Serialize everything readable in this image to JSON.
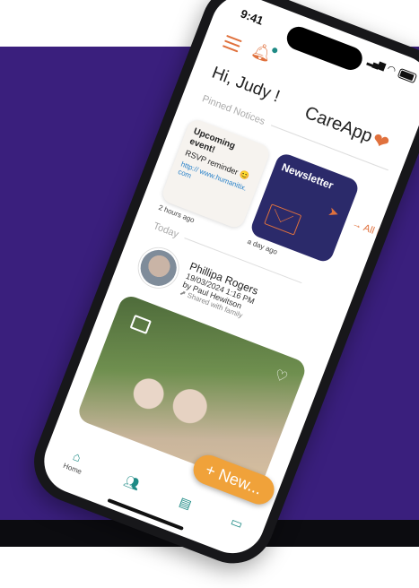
{
  "status": {
    "time": "9:41"
  },
  "header": {
    "greeting": "Hi, Judy !",
    "logo": "CareApp"
  },
  "pinned": {
    "label": "Pinned Notices",
    "event": {
      "title": "Upcoming event!",
      "line": "RSVP reminder 😊",
      "link": "http:// www.humanitix.com",
      "time": "2 hours ago"
    },
    "newsletter": {
      "title": "Newsletter",
      "time": "a day ago"
    },
    "see_all": "→ All Noti"
  },
  "today": {
    "label": "Today",
    "post": {
      "name": "Phillipa Rogers",
      "date": "19/03/2024 1:16 PM",
      "by": "by Paul Hewitson",
      "shared": "⬈ Shared with family"
    }
  },
  "new_button": "+ New...",
  "nav": {
    "home_label": "Home"
  },
  "colors": {
    "accent": "#e0713d",
    "teal": "#1e8a85",
    "band": "#3a1f7d"
  }
}
